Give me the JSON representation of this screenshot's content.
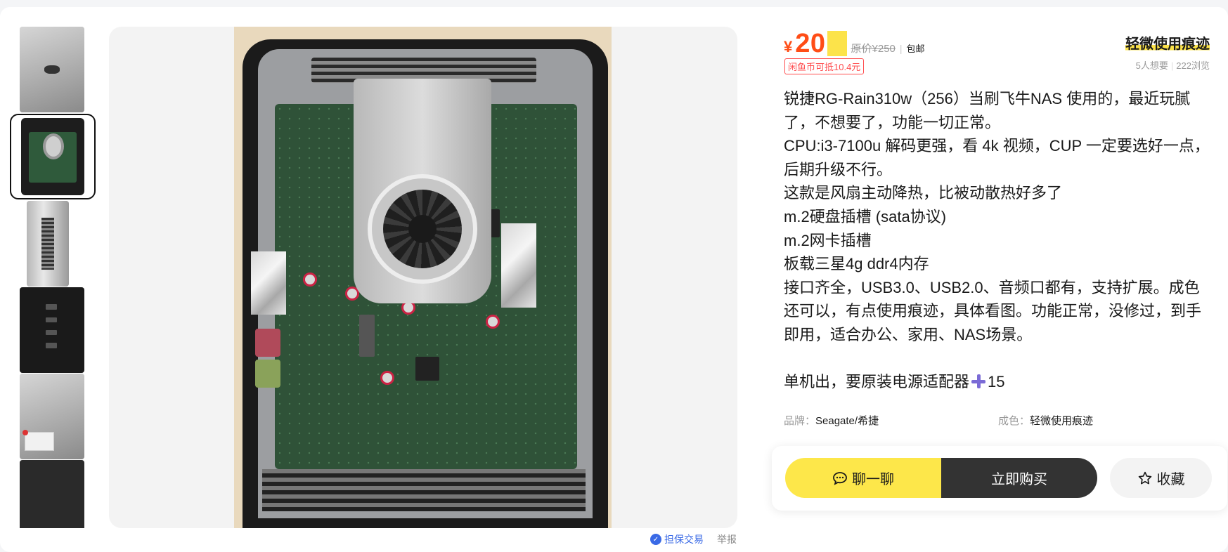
{
  "price": {
    "currency_symbol": "¥",
    "value": "20",
    "original_price": "原价¥250",
    "separator": "|",
    "shipping": "包邮",
    "coin_offset": "闲鱼币可抵10.4元"
  },
  "condition": "轻微使用痕迹",
  "stats": {
    "wants": "5人想要",
    "views": "222浏览"
  },
  "description": [
    "锐捷RG-Rain310w（256）当刷飞牛NAS 使用的，最近玩腻了，不想要了，功能一切正常。",
    "CPU:i3-7100u 解码更强，看 4k 视频，CUP 一定要选好一点，后期升级不行。",
    "这款是风扇主动降热，比被动散热好多了",
    "m.2硬盘插槽 (sata协议)",
    "m.2网卡插槽",
    "板载三星4g ddr4内存",
    "接口齐全，USB3.0、USB2.0、音频口都有，支持扩展。成色还可以，有点使用痕迹，具体看图。功能正常，没修过，到手即用，适合办公、家用、NAS场景。"
  ],
  "description_extra": {
    "prefix": "单机出，要原装电源适配器",
    "icon": "plus-icon",
    "suffix": "15"
  },
  "attributes": [
    {
      "key": "品牌：",
      "value": "Seagate/希捷"
    },
    {
      "key": "成色：",
      "value": "轻微使用痕迹"
    }
  ],
  "footer_links": {
    "guarantee": "担保交易",
    "report": "举报"
  },
  "actions": {
    "chat": "聊一聊",
    "buy": "立即购买",
    "favorite": "收藏"
  },
  "colors": {
    "price": "#ff4d16",
    "accent_yellow": "#fde74a",
    "buy_button": "#333333",
    "guarantee_blue": "#3a6ae6"
  },
  "thumbnails": [
    {
      "name": "device-top-photo",
      "selected": false
    },
    {
      "name": "device-open-board-photo",
      "selected": true
    },
    {
      "name": "device-side-photo",
      "selected": false
    },
    {
      "name": "device-back-ports-photo",
      "selected": false
    },
    {
      "name": "device-label-photo",
      "selected": false
    },
    {
      "name": "device-partial-photo",
      "selected": false
    }
  ]
}
